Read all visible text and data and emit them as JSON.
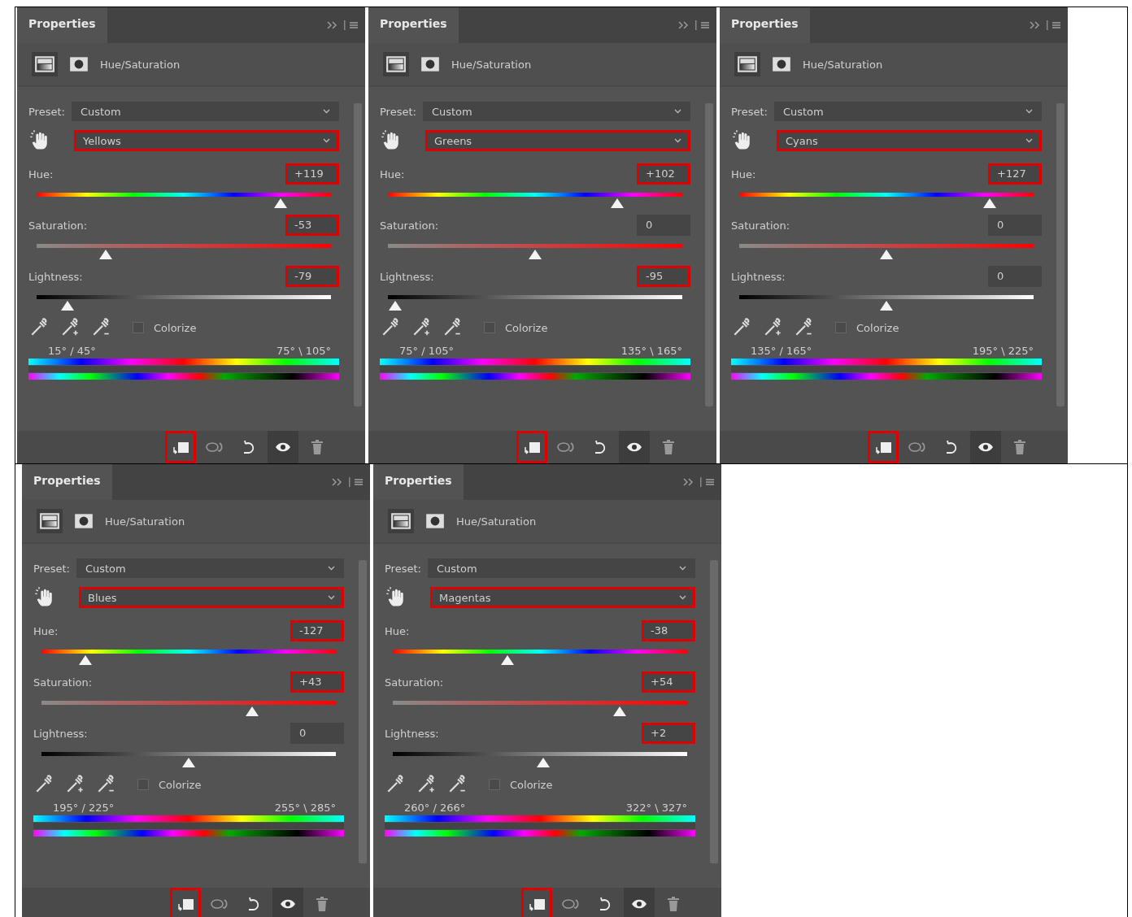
{
  "rows": [
    {
      "panels": [
        {
          "tab": "Properties",
          "header": "Hue/Saturation",
          "preset_label": "Preset:",
          "preset": "Custom",
          "channel": "Yellows",
          "channel_highlighted": true,
          "colorize_label": "Colorize",
          "colorize_checked": false,
          "range_left": "15° / 45°",
          "range_right": "75° \\ 105°",
          "clip_highlighted": true,
          "sliders": [
            {
              "kind": "hue",
              "label": "Hue:",
              "value": "+119",
              "level": 0.83,
              "highlighted": true
            },
            {
              "kind": "saturation",
              "label": "Saturation:",
              "value": "-53",
              "level": 0.235,
              "highlighted": true
            },
            {
              "kind": "lightness",
              "label": "Lightness:",
              "value": "-79",
              "level": 0.105,
              "highlighted": true
            }
          ]
        },
        {
          "tab": "Properties",
          "header": "Hue/Saturation",
          "preset_label": "Preset:",
          "preset": "Custom",
          "channel": "Greens",
          "channel_highlighted": true,
          "colorize_label": "Colorize",
          "colorize_checked": false,
          "range_left": "75° / 105°",
          "range_right": "135° \\ 165°",
          "clip_highlighted": true,
          "sliders": [
            {
              "kind": "hue",
              "label": "Hue:",
              "value": "+102",
              "level": 0.78,
              "highlighted": true
            },
            {
              "kind": "saturation",
              "label": "Saturation:",
              "value": "0",
              "level": 0.5,
              "highlighted": false
            },
            {
              "kind": "lightness",
              "label": "Lightness:",
              "value": "-95",
              "level": 0.025,
              "highlighted": true
            }
          ]
        },
        {
          "tab": "Properties",
          "header": "Hue/Saturation",
          "preset_label": "Preset:",
          "preset": "Custom",
          "channel": "Cyans",
          "channel_highlighted": true,
          "colorize_label": "Colorize",
          "colorize_checked": false,
          "range_left": "135° / 165°",
          "range_right": "195° \\ 225°",
          "clip_highlighted": true,
          "sliders": [
            {
              "kind": "hue",
              "label": "Hue:",
              "value": "+127",
              "level": 0.85,
              "highlighted": true
            },
            {
              "kind": "saturation",
              "label": "Saturation:",
              "value": "0",
              "level": 0.5,
              "highlighted": false
            },
            {
              "kind": "lightness",
              "label": "Lightness:",
              "value": "0",
              "level": 0.5,
              "highlighted": false
            }
          ]
        }
      ]
    },
    {
      "panels": [
        {
          "tab": "Properties",
          "header": "Hue/Saturation",
          "preset_label": "Preset:",
          "preset": "Custom",
          "channel": "Blues",
          "channel_highlighted": true,
          "colorize_label": "Colorize",
          "colorize_checked": false,
          "range_left": "195° / 225°",
          "range_right": "255° \\ 285°",
          "clip_highlighted": true,
          "sliders": [
            {
              "kind": "hue",
              "label": "Hue:",
              "value": "-127",
              "level": 0.15,
              "highlighted": true
            },
            {
              "kind": "saturation",
              "label": "Saturation:",
              "value": "+43",
              "level": 0.715,
              "highlighted": true
            },
            {
              "kind": "lightness",
              "label": "Lightness:",
              "value": "0",
              "level": 0.5,
              "highlighted": false
            }
          ]
        },
        {
          "tab": "Properties",
          "header": "Hue/Saturation",
          "preset_label": "Preset:",
          "preset": "Custom",
          "channel": "Magentas",
          "channel_highlighted": true,
          "colorize_label": "Colorize",
          "colorize_checked": false,
          "range_left": "260° / 266°",
          "range_right": "322° \\ 327°",
          "clip_highlighted": true,
          "sliders": [
            {
              "kind": "hue",
              "label": "Hue:",
              "value": "-38",
              "level": 0.39,
              "highlighted": true
            },
            {
              "kind": "saturation",
              "label": "Saturation:",
              "value": "+54",
              "level": 0.77,
              "highlighted": true
            },
            {
              "kind": "lightness",
              "label": "Lightness:",
              "value": "+2",
              "level": 0.51,
              "highlighted": true
            }
          ]
        }
      ]
    }
  ]
}
